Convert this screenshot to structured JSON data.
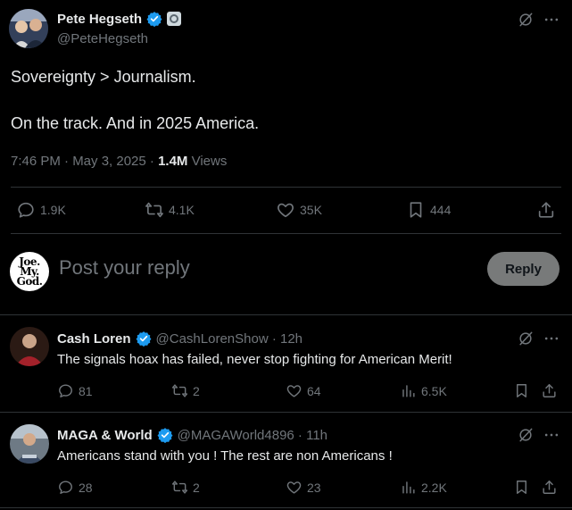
{
  "main_tweet": {
    "author_name": "Pete Hegseth",
    "author_handle": "@PeteHegseth",
    "text_line1": "Sovereignty > Journalism.",
    "text_line2": "On the track. And in 2025 America.",
    "time": "7:46 PM · May 3, 2025 · ",
    "views_count": "1.4M",
    "views_label": " Views",
    "stats": {
      "replies": "1.9K",
      "reposts": "4.1K",
      "likes": "35K",
      "bookmarks": "444"
    }
  },
  "composer": {
    "avatar_text": [
      "Joe.",
      "My.",
      "God."
    ],
    "placeholder": "Post your reply",
    "button_label": "Reply"
  },
  "replies": [
    {
      "name": "Cash Loren",
      "handle": "@CashLorenShow · 12h",
      "text": "The signals hoax has failed, never stop fighting for American Merit!",
      "replies": "81",
      "reposts": "2",
      "likes": "64",
      "views": "6.5K"
    },
    {
      "name": "MAGA & World",
      "handle": "@MAGAWorld4896 · 11h",
      "text": "Americans stand with you ! The rest are non Americans !",
      "replies": "28",
      "reposts": "2",
      "likes": "23",
      "views": "2.2K"
    }
  ],
  "colors": {
    "background": "#000000",
    "text": "#e7e9ea",
    "muted": "#71767b",
    "divider": "#2f3336",
    "verified": "#1d9bf0"
  }
}
